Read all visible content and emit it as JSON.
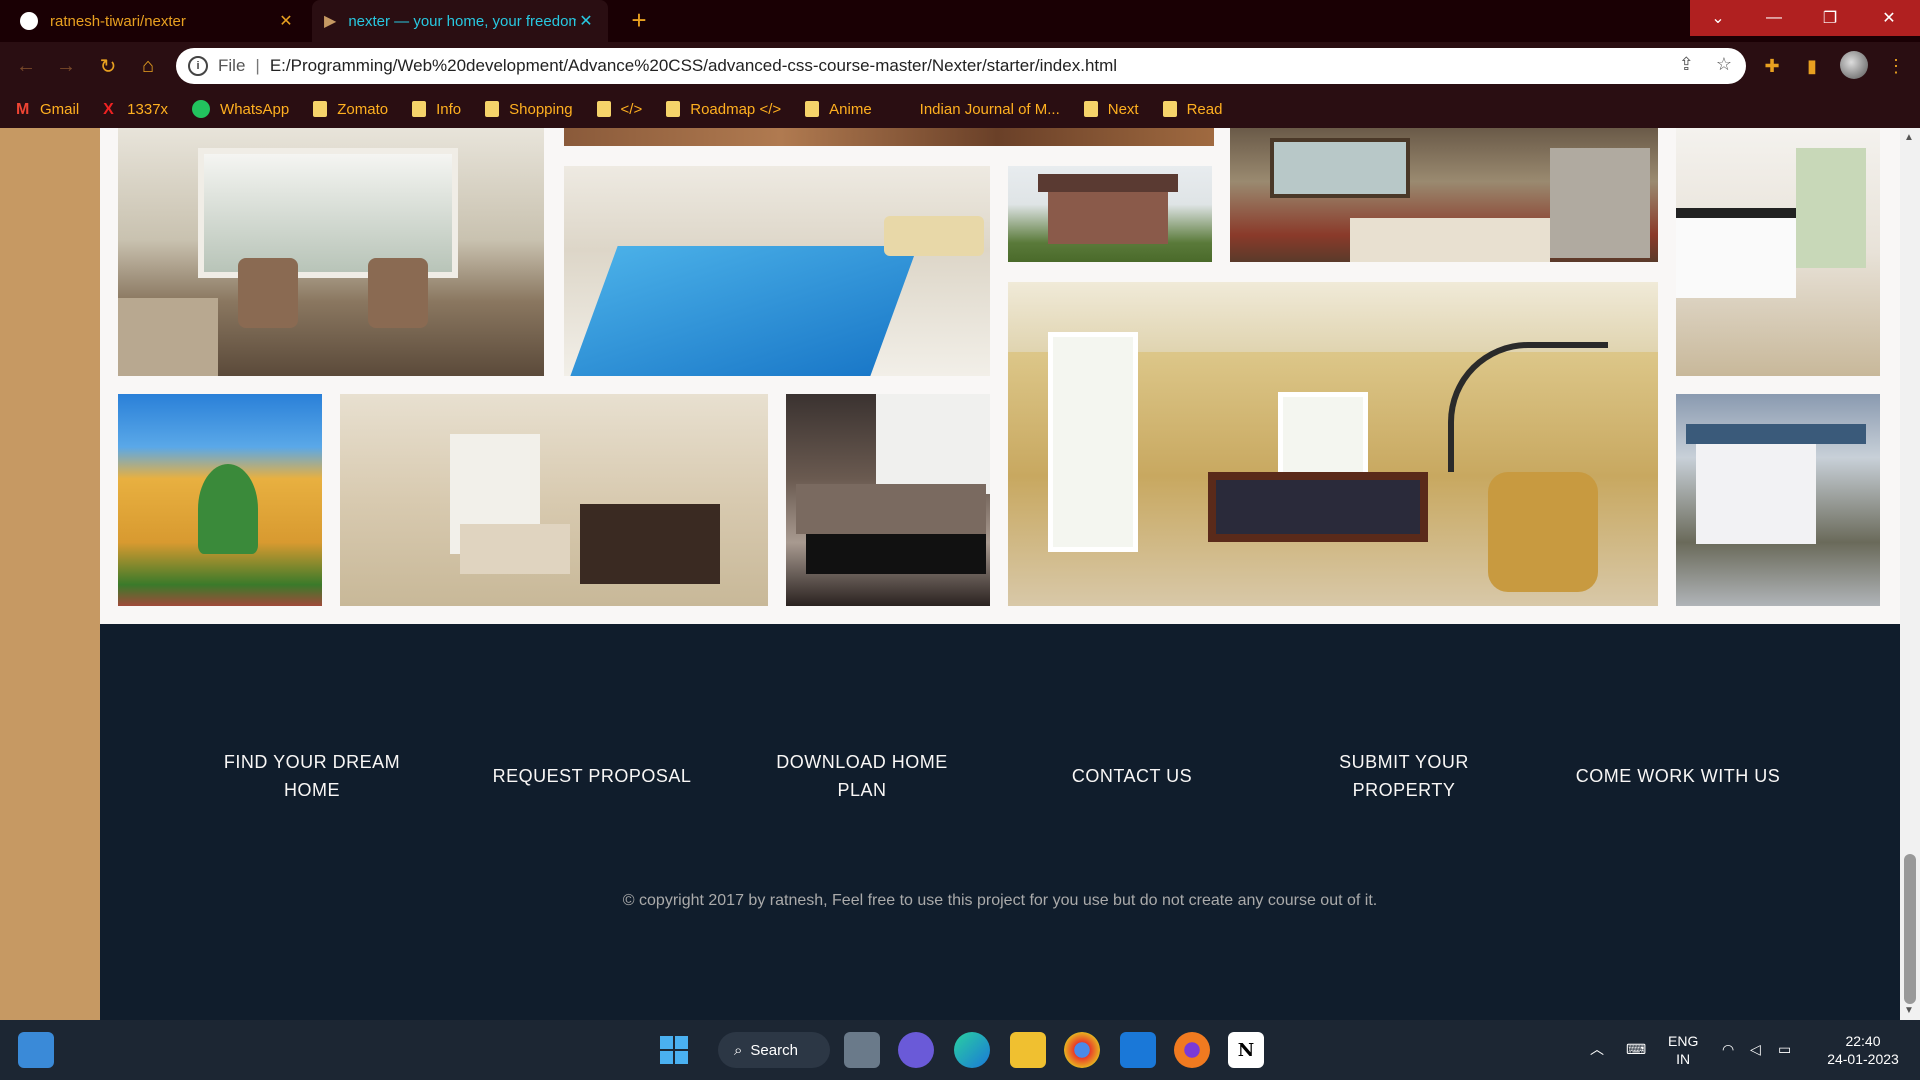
{
  "browser": {
    "tabs": [
      {
        "title": "ratnesh-tiwari/nexter",
        "icon": "github-icon"
      },
      {
        "title": "nexter — your home, your freedom",
        "icon": "nexter-favicon-icon"
      }
    ],
    "new_tab": "+",
    "address": {
      "scheme": "File",
      "url": "E:/Programming/Web%20development/Advance%20CSS/advanced-css-course-master/Nexter/starter/index.html"
    },
    "bookmarks": [
      {
        "label": "Gmail",
        "icon": "gmail-icon"
      },
      {
        "label": "1337x",
        "icon": "x-icon"
      },
      {
        "label": "WhatsApp",
        "icon": "whatsapp-icon"
      },
      {
        "label": "Zomato",
        "icon": "folder-icon"
      },
      {
        "label": "Info",
        "icon": "folder-icon"
      },
      {
        "label": "Shopping",
        "icon": "folder-icon"
      },
      {
        "label": "</>",
        "icon": "folder-icon"
      },
      {
        "label": "Roadmap </>",
        "icon": "folder-icon"
      },
      {
        "label": "Anime",
        "icon": "folder-icon"
      },
      {
        "label": "Indian Journal of M...",
        "icon": "none"
      },
      {
        "label": "Next",
        "icon": "folder-icon"
      },
      {
        "label": "Read",
        "icon": "folder-icon"
      }
    ]
  },
  "footer": {
    "links": [
      "FIND YOUR DREAM HOME",
      "REQUEST PROPOSAL",
      "DOWNLOAD HOME PLAN",
      "CONTACT US",
      "SUBMIT YOUR PROPERTY",
      "COME WORK WITH US"
    ],
    "copyright": "© copyright 2017 by ratnesh, Feel free to use this project for you use but do not create any course out of it."
  },
  "gallery": [
    "living-room-photo",
    "pool-photo",
    "house-photo",
    "lounge-photo",
    "kitchen-photo",
    "billiards-room-photo",
    "villa-photo",
    "dining-room-photo",
    "sofa-room-photo",
    "white-house-photo",
    "floor-photo"
  ],
  "taskbar": {
    "search": "Search",
    "lang": "ENG",
    "region": "IN",
    "time": "22:40",
    "date": "24-01-2023"
  },
  "colors": {
    "primary": "#c69963",
    "dark": "#101d2c",
    "light": "#f9f7f6",
    "chrome": "#2a0e12"
  }
}
